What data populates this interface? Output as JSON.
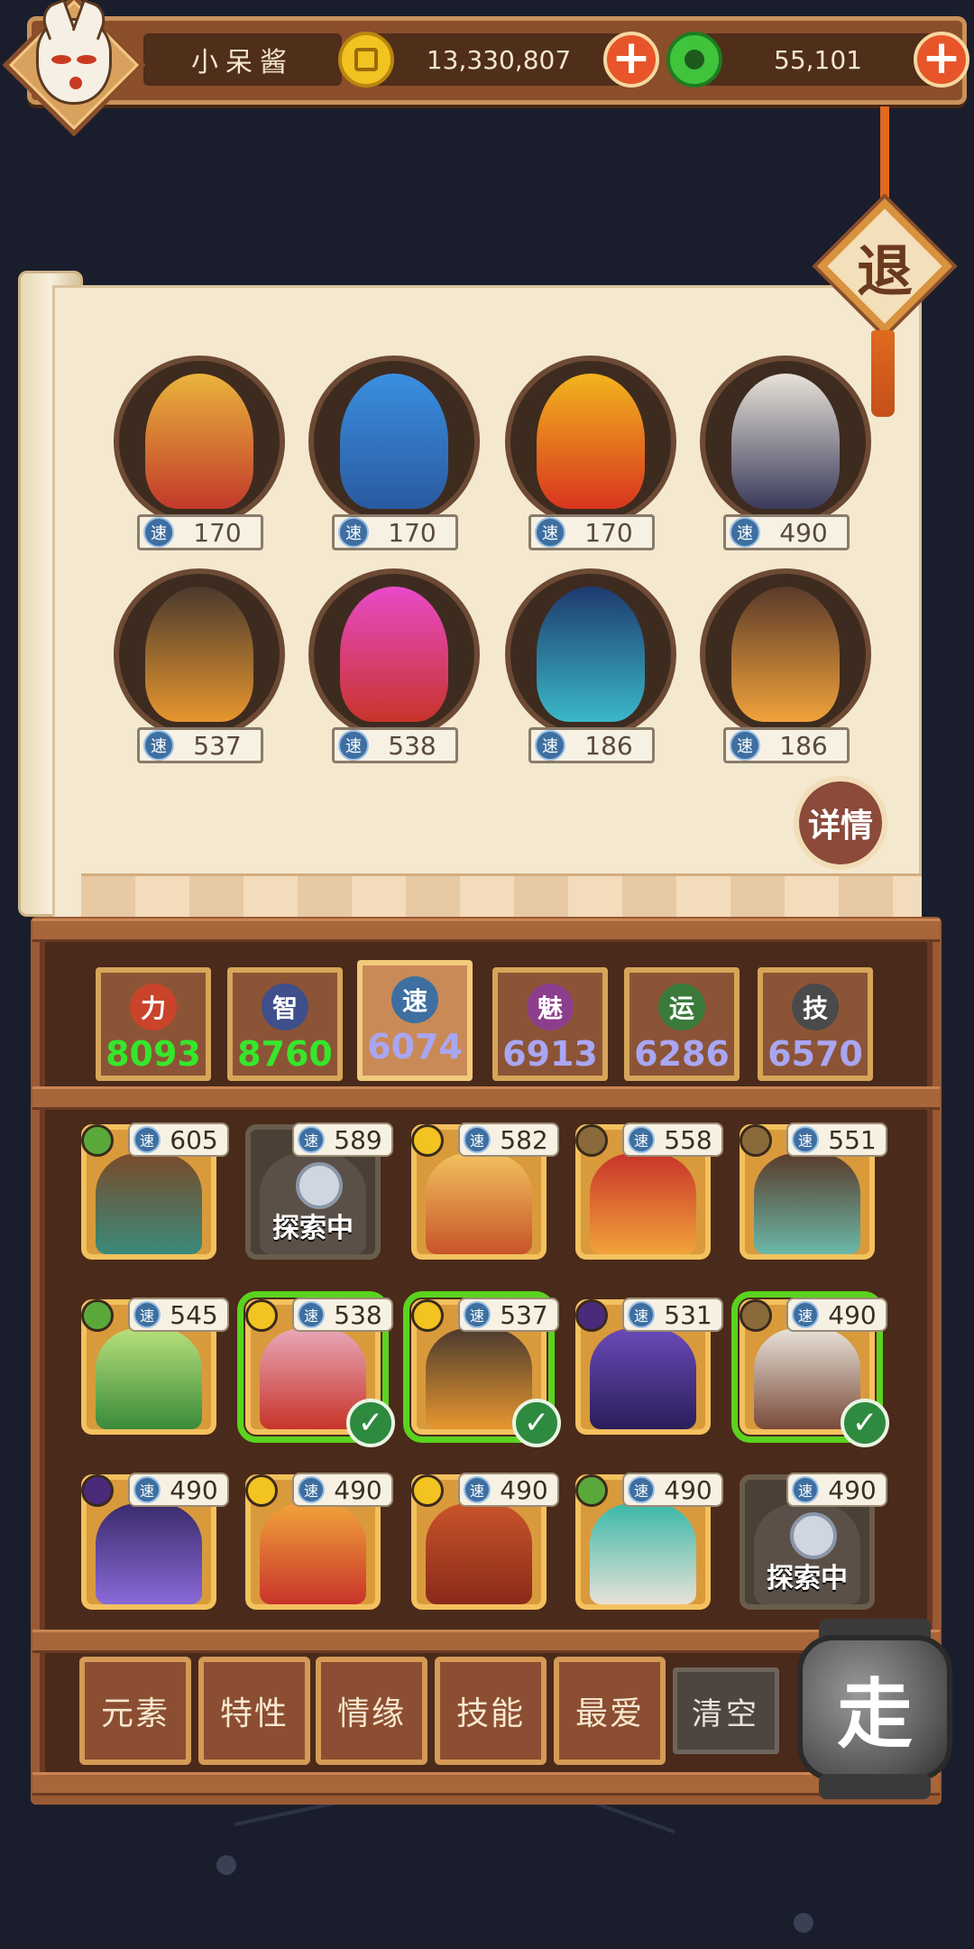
{
  "colors": {
    "power": "#c9442a",
    "intellect": "#3e4f8c",
    "speed": "#3e6fa0",
    "charm": "#8c3e8c",
    "luck": "#3a7a3a",
    "skill": "#4a4a4a",
    "green_value": "#35e62b",
    "purple_value": "#a9a6f2"
  },
  "header": {
    "player_name": "小呆酱",
    "gold_amount": "13,330,807",
    "jade_amount": "55,101",
    "gold_icon": "gold-coin-icon",
    "jade_icon": "jade-coin-icon",
    "plus_symbol": "+"
  },
  "exit_button": {
    "label": "退"
  },
  "selected_team": {
    "heroes": [
      {
        "speed": "170"
      },
      {
        "speed": "170"
      },
      {
        "speed": "170"
      },
      {
        "speed": "490"
      },
      {
        "speed": "537"
      },
      {
        "speed": "538"
      },
      {
        "speed": "186"
      },
      {
        "speed": "186"
      }
    ],
    "speed_glyph": "速",
    "details_label": "详情"
  },
  "stats": [
    {
      "glyph": "力",
      "value": "8093"
    },
    {
      "glyph": "智",
      "value": "8760"
    },
    {
      "glyph": "速",
      "value": "6074"
    },
    {
      "glyph": "魅",
      "value": "6913"
    },
    {
      "glyph": "运",
      "value": "6286"
    },
    {
      "glyph": "技",
      "value": "6570"
    }
  ],
  "roster": [
    {
      "speed": "605"
    },
    {
      "speed": "589",
      "status": "探索中"
    },
    {
      "speed": "582"
    },
    {
      "speed": "558"
    },
    {
      "speed": "551"
    },
    {
      "speed": "545"
    },
    {
      "speed": "538"
    },
    {
      "speed": "537"
    },
    {
      "speed": "531"
    },
    {
      "speed": "490"
    },
    {
      "speed": "490"
    },
    {
      "speed": "490"
    },
    {
      "speed": "490"
    },
    {
      "speed": "490"
    },
    {
      "speed": "490",
      "status": "探索中"
    }
  ],
  "filters": {
    "element": "元素",
    "trait": "特性",
    "bond": "情缘",
    "skill": "技能",
    "favorite": "最爱",
    "clear": "清空"
  },
  "go_button": {
    "label": "走"
  }
}
